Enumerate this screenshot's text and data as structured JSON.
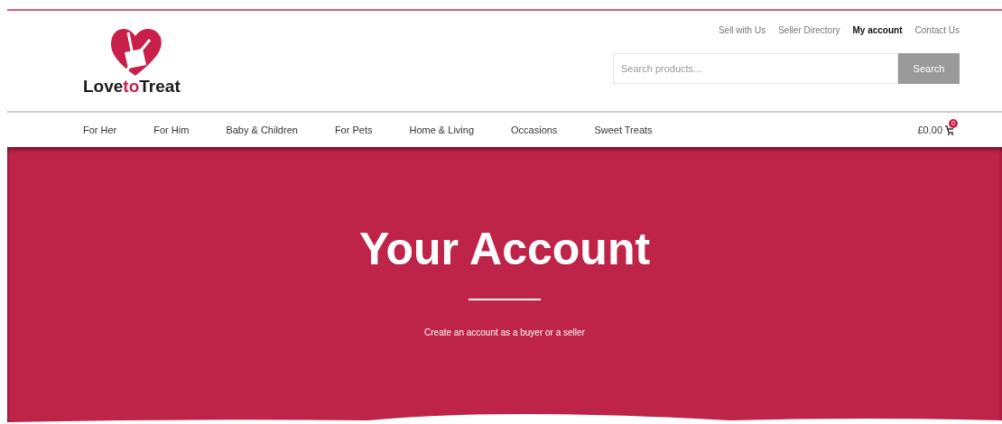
{
  "logo": {
    "text_before": "Love",
    "text_accent": "to",
    "text_after": "Treat"
  },
  "top_links": [
    {
      "label": "Sell with Us",
      "selected": false
    },
    {
      "label": "Seller Directory",
      "selected": false
    },
    {
      "label": "My account",
      "selected": true
    },
    {
      "label": "Contact Us",
      "selected": false
    }
  ],
  "search": {
    "placeholder": "Search products...",
    "button": "Search"
  },
  "nav": [
    "For Her",
    "For Him",
    "Baby & Children",
    "For Pets",
    "Home & Living",
    "Occasions",
    "Sweet Treats"
  ],
  "cart": {
    "total": "£0.00",
    "count": "0"
  },
  "hero": {
    "title": "Your Account",
    "subtitle": "Create an account as a buyer or a seller"
  }
}
